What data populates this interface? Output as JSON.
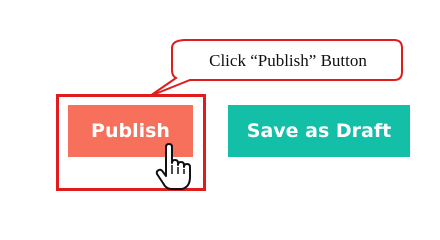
{
  "callout": {
    "text": "Click “Publish” Button"
  },
  "buttons": {
    "publish_label": "Publish",
    "save_draft_label": "Save as Draft"
  },
  "colors": {
    "publish_bg": "#f7705c",
    "draft_bg": "#13bfa6",
    "highlight": "#e11c1c"
  },
  "icons": {
    "cursor": "hand-pointer-icon"
  }
}
